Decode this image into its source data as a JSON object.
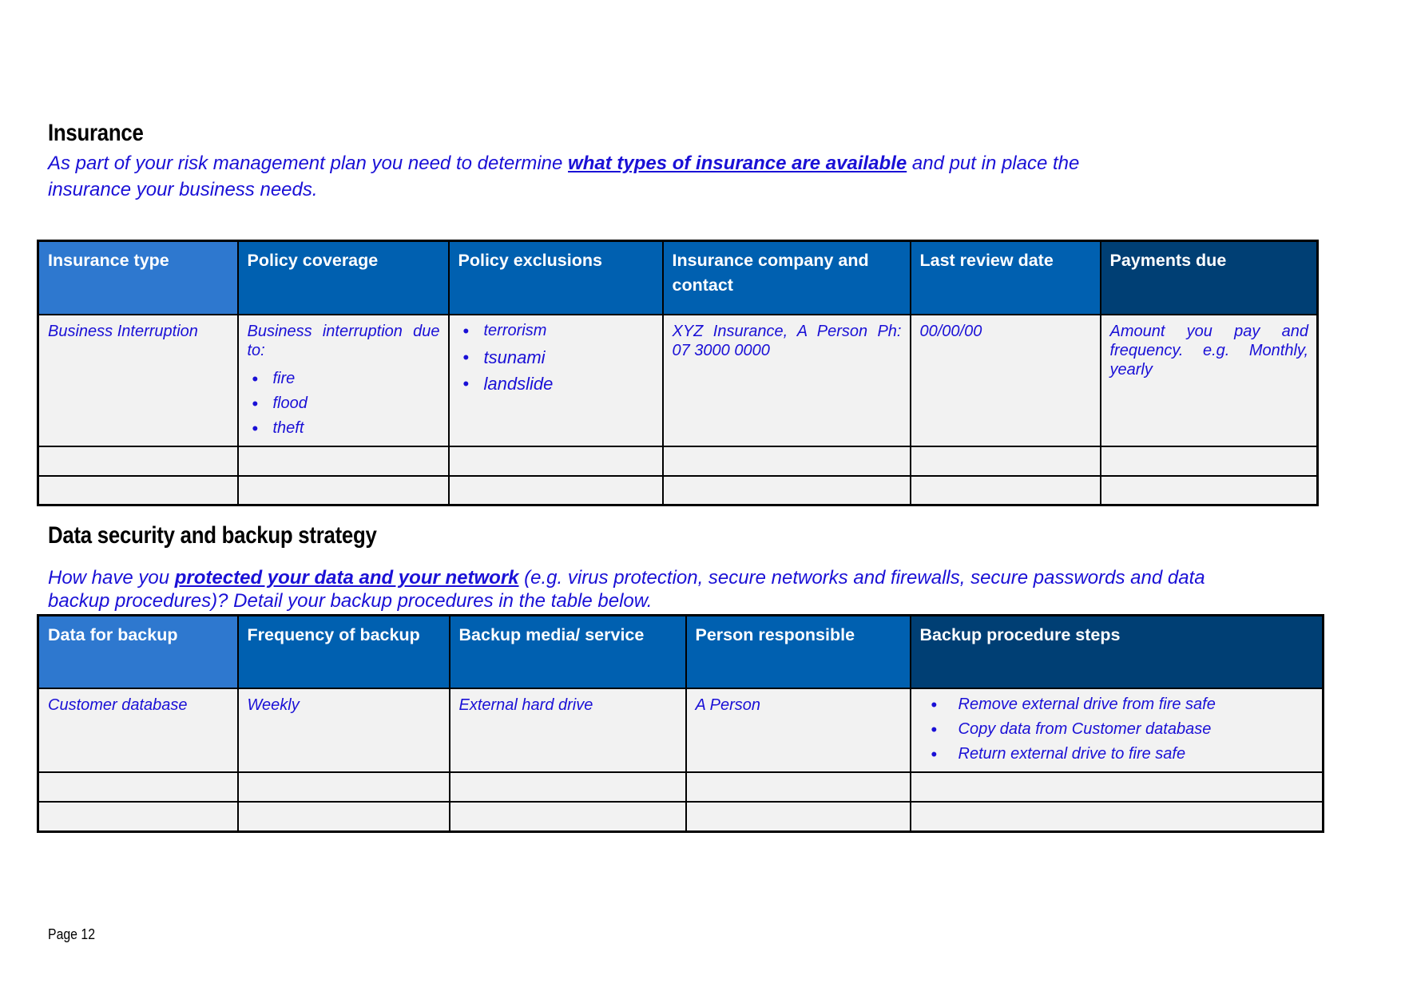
{
  "insurance": {
    "title": "Insurance",
    "intro_before": "As part of your risk management plan you need to determine ",
    "intro_link": "what types of insurance are available",
    "intro_after": " and put in place the insurance your business needs.",
    "headers": [
      "Insurance type",
      "Policy coverage",
      "Policy exclusions",
      "Insurance company and contact",
      "Last review date",
      "Payments due"
    ],
    "row": {
      "type": "Business Interruption",
      "coverage_intro": "Business interruption due to:",
      "coverage_items": [
        "fire",
        "flood",
        "theft"
      ],
      "exclusions": [
        "terrorism",
        "tsunami",
        "landslide"
      ],
      "company": "XYZ Insurance, A Person Ph: 07 3000 0000",
      "review_date": "00/00/00",
      "payments": "Amount you pay and frequency. e.g. Monthly, yearly"
    }
  },
  "backup": {
    "title": "Data security and backup strategy",
    "intro_before": "How have you ",
    "intro_link": "protected your data and your network",
    "intro_after": " (e.g. virus protection, secure networks and firewalls, secure passwords and data backup procedures)? Detail your backup procedures in the table below.",
    "headers": [
      "Data for backup",
      "Frequency of backup",
      "Backup media/ service",
      "Person responsible",
      "Backup procedure steps"
    ],
    "row": {
      "data": "Customer database",
      "frequency": "Weekly",
      "media": "External hard drive",
      "person": "A Person",
      "steps": [
        "Remove external drive from fire safe",
        "Copy data from Customer database",
        "Return external drive to fire safe"
      ]
    }
  },
  "footer": {
    "page": "Page 12"
  }
}
